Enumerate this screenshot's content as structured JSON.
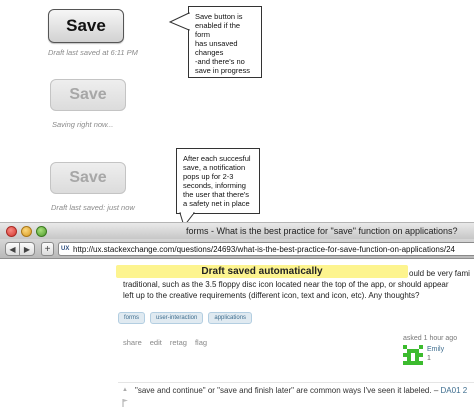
{
  "mockups": {
    "save_label": "Save",
    "state1_note": "Draft last saved at 6:11 PM",
    "state2_note": "Saving right now...",
    "state3_note": "Draft last saved: just now"
  },
  "callouts": {
    "top": "Save button is\nenabled if  the form\nhas unsaved\nchanges\n-and there's no\nsave in progress",
    "bottom": "After each succesful\nsave, a notification\npops up for 2-3\nseconds, informing\nthe user that there's\na safety net in place"
  },
  "browser": {
    "window_title": "forms - What is the best practice for \"save\" function on applications?",
    "back_glyph": "◀",
    "forward_glyph": "▶",
    "add_glyph": "+",
    "url": "http://ux.stackexchange.com/questions/24693/what-is-the-best-practice-for-save-function-on-applications/24",
    "site_icon": "UX"
  },
  "page": {
    "toast": "Draft saved automatically",
    "question_lines": [
      "ould be very fami",
      "traditional, such as the 3.5 floppy disc icon located near the top of the app, or should appear",
      "left up to the creative requirements (different icon, text and icon, etc). Any thoughts?"
    ],
    "tags": [
      "forms",
      "user-interaction",
      "applications"
    ],
    "actions": [
      "share",
      "edit",
      "retag",
      "flag"
    ],
    "asked": "asked 1 hour ago",
    "user_name": "Emily",
    "user_rep": "1",
    "comment_text": "\"save and continue\" or \"save and finish later\" are common ways I've seen it labeled. – ",
    "comment_author": "DA01 2",
    "vote_glyph": "▲"
  },
  "colors": {
    "toast_bg": "#fdf48f",
    "tag_text": "#3e6d8e",
    "avatar": "#3cbb2e"
  },
  "icons": {
    "avatar": "identicon",
    "flag": "flag-icon"
  }
}
